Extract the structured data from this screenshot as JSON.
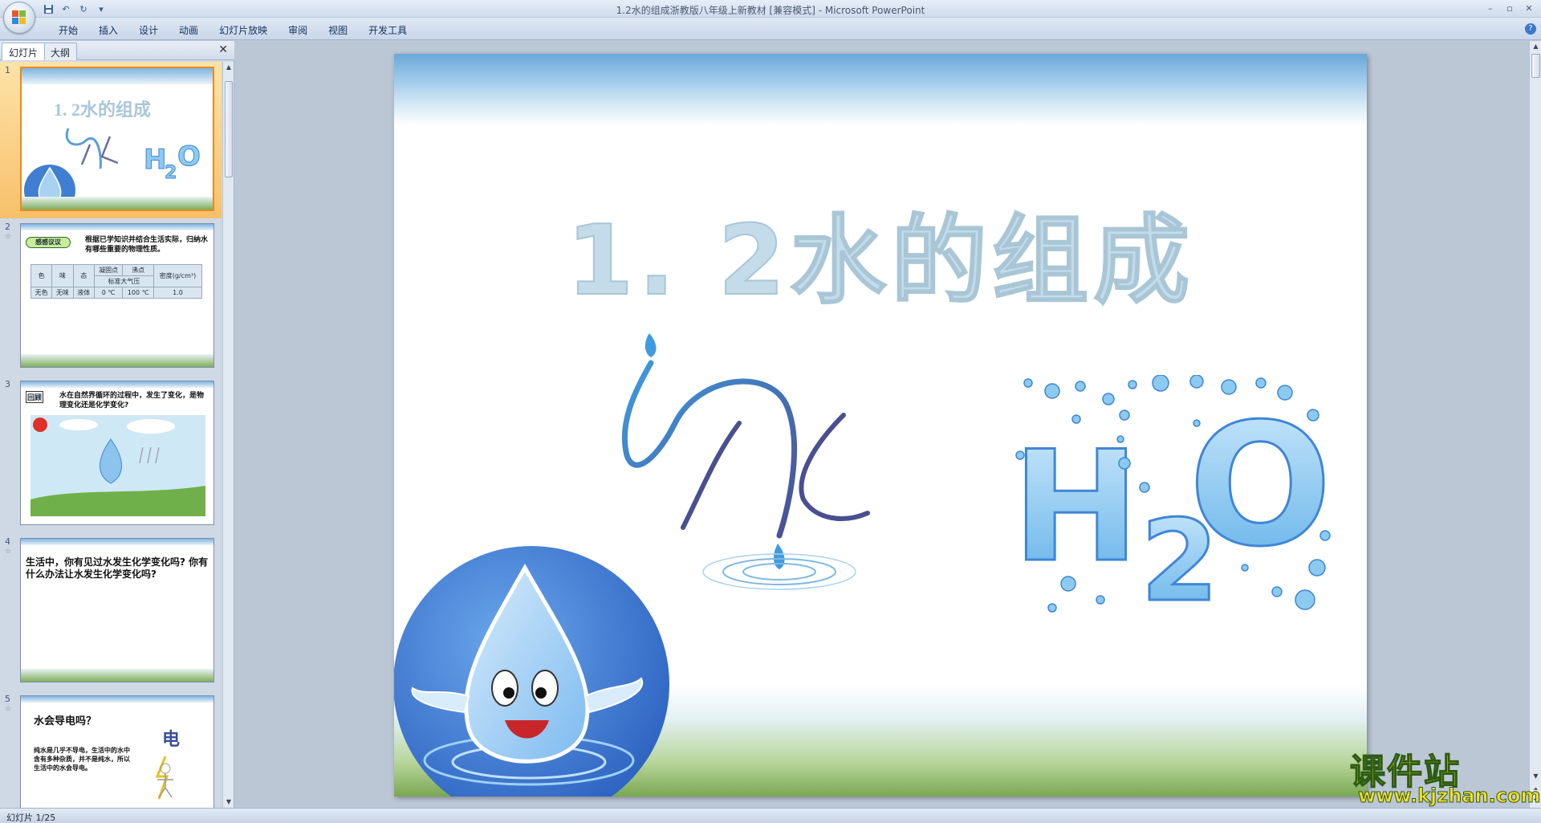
{
  "window": {
    "title": "1.2水的组成浙教版八年级上新教材 [兼容模式] - Microsoft PowerPoint"
  },
  "ribbon": {
    "tabs": [
      "开始",
      "插入",
      "设计",
      "动画",
      "幻灯片放映",
      "审阅",
      "视图",
      "开发工具"
    ]
  },
  "pane": {
    "tabs": [
      "幻灯片",
      "大纲"
    ],
    "close_glyph": "✕"
  },
  "thumbnails": [
    {
      "num": "1",
      "title": "1. 2水的组成"
    },
    {
      "num": "2",
      "badge": "感感议议",
      "text": "根据已学知识并结合生活实际，归纳水有哪些重要的物理性质。",
      "table": {
        "headers": [
          "色",
          "味",
          "态",
          "凝固点",
          "沸点",
          "密度(g/cm³)"
        ],
        "subheader": "标准大气压",
        "values": [
          "无色",
          "无味",
          "液体",
          "0 ℃",
          "100 ℃",
          "1.0"
        ]
      }
    },
    {
      "num": "3",
      "badge": "回顾",
      "text": "水在自然界循环的过程中，发生了变化，是物理变化还是化学变化?"
    },
    {
      "num": "4",
      "text": "生活中，你有见过水发生化学变化吗? 你有什么办法让水发生化学变化吗?"
    },
    {
      "num": "5",
      "heading": "水会导电吗？",
      "label": "电",
      "text": "纯水是几乎不导电，生活中的水中含有多种杂质，并不是纯水，所以生活中的水会导电。"
    }
  ],
  "slide": {
    "title": "1. 2水的组成",
    "art_char": "水",
    "formula_main": "H",
    "formula_sub": "2",
    "formula_end": "O"
  },
  "status": {
    "slide_counter": "幻灯片 1/25"
  },
  "watermark": {
    "text": "课件站",
    "url": "www.kjzhan.com"
  },
  "colors": {
    "ribbon": "#cfdcec",
    "selection": "#f7c06a",
    "title_text": "#c4dcea",
    "drop_blue": "#3f86d6",
    "watermark_yellow": "#f6dc2a"
  }
}
